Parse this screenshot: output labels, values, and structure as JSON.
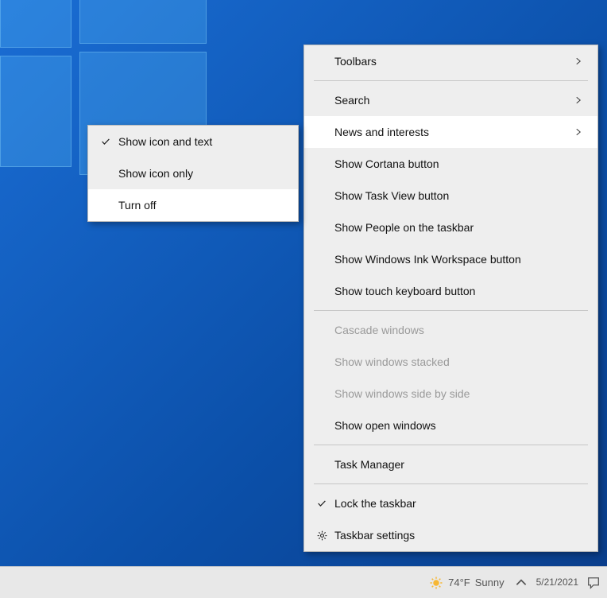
{
  "desktop": {},
  "context_menu": {
    "items": [
      {
        "label": "Toolbars",
        "submenu": true
      },
      {
        "separator": true
      },
      {
        "label": "Search",
        "submenu": true
      },
      {
        "label": "News and interests",
        "submenu": true,
        "hovered": true
      },
      {
        "label": "Show Cortana button"
      },
      {
        "label": "Show Task View button"
      },
      {
        "label": "Show People on the taskbar"
      },
      {
        "label": "Show Windows Ink Workspace button"
      },
      {
        "label": "Show touch keyboard button"
      },
      {
        "separator": true
      },
      {
        "label": "Cascade windows",
        "disabled": true
      },
      {
        "label": "Show windows stacked",
        "disabled": true
      },
      {
        "label": "Show windows side by side",
        "disabled": true
      },
      {
        "label": "Show open windows"
      },
      {
        "separator": true
      },
      {
        "label": "Task Manager"
      },
      {
        "separator": true
      },
      {
        "label": "Lock the taskbar",
        "checked": true
      },
      {
        "label": "Taskbar settings",
        "icon": "gear"
      }
    ]
  },
  "submenu": {
    "items": [
      {
        "label": "Show icon and text",
        "checked": true
      },
      {
        "label": "Show icon only"
      },
      {
        "label": "Turn off",
        "hovered": true
      }
    ]
  },
  "taskbar": {
    "weather": {
      "temp": "74°F",
      "condition": "Sunny"
    },
    "date": "5/21/2021"
  }
}
